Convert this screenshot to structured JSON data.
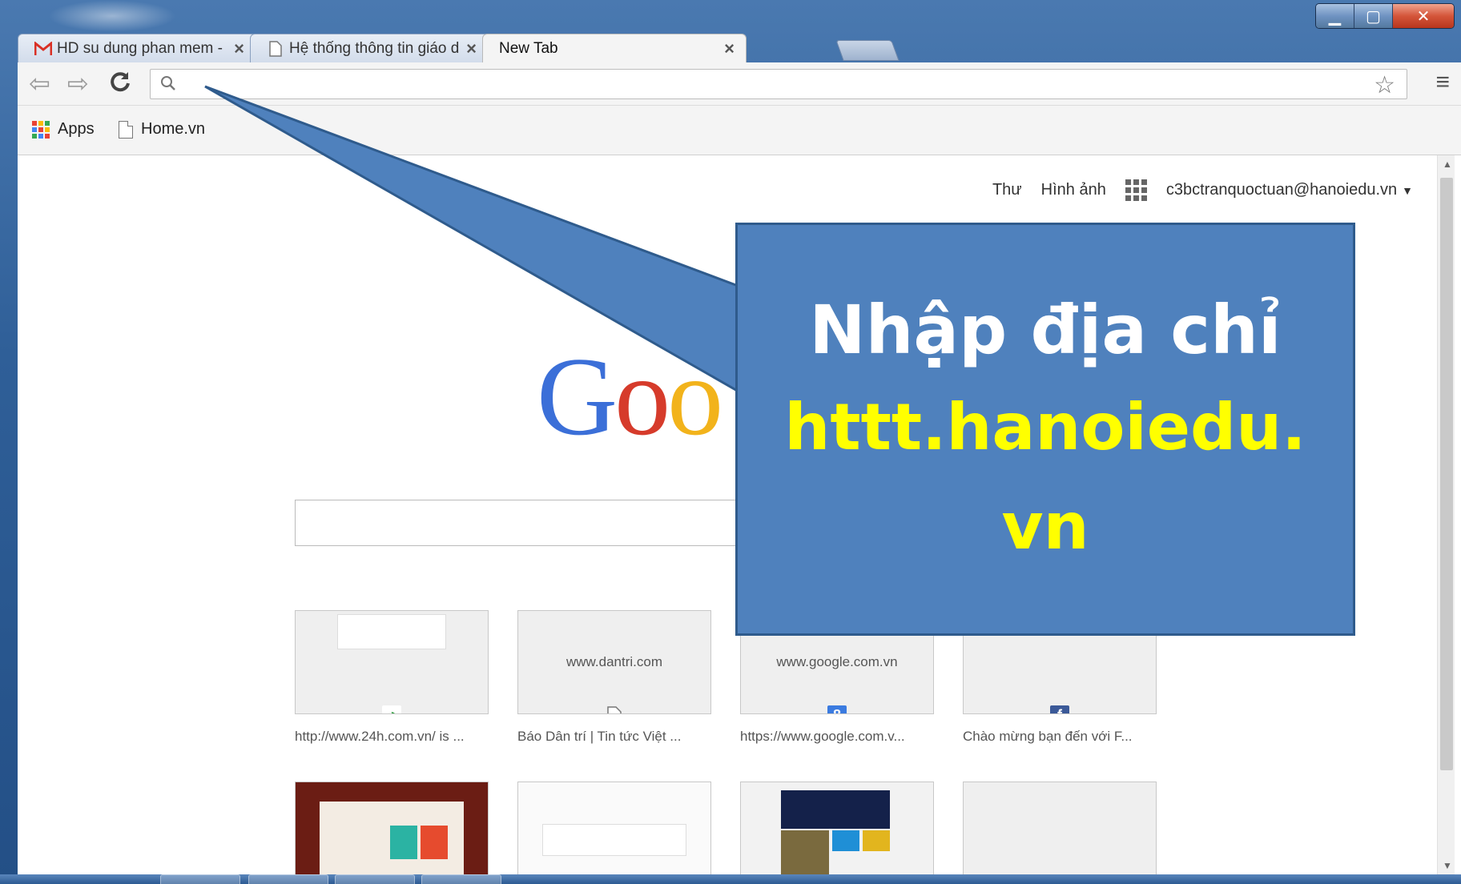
{
  "browser": {
    "tabs": [
      {
        "title": "HD su dung phan mem -",
        "icon": "gmail-icon",
        "active": false
      },
      {
        "title": "Hệ thống thông tin giáo d",
        "icon": "page-icon",
        "active": false
      },
      {
        "title": "New Tab",
        "icon": "",
        "active": true
      }
    ],
    "tab_close_glyph": "×",
    "omnibox": {
      "value": "",
      "placeholder": ""
    },
    "bookmarks": [
      {
        "label": "Apps",
        "icon": "apps-grid-icon"
      },
      {
        "label": "Home.vn",
        "icon": "page-icon"
      }
    ]
  },
  "newtab": {
    "header_links": [
      "Thư",
      "Hình ảnh"
    ],
    "account": "c3bctranquoctuan@hanoiedu.vn",
    "logo_visible": "Goo",
    "tiles_row1": [
      {
        "thumb_text": "",
        "caption": "http://www.24h.com.vn/ is ...",
        "fav_color": "#3fa34d",
        "fav_glyph": "◔"
      },
      {
        "thumb_text": "www.dantri.com",
        "caption": "Báo Dân trí | Tin tức Việt ...",
        "fav_color": "#ffffff",
        "fav_glyph": ""
      },
      {
        "thumb_text": "www.google.com.vn",
        "caption": "https://www.google.com.v...",
        "fav_color": "#3b7be0",
        "fav_glyph": "8"
      },
      {
        "thumb_text": "",
        "caption": "Chào mừng bạn đến với F...",
        "fav_color": "#3b5998",
        "fav_glyph": "f"
      }
    ]
  },
  "callout": {
    "line1": "Nhập địa chỉ",
    "line2": "httt.hanoiedu.",
    "line3": "vn",
    "fill": "#4f81bd",
    "text_color": "#ffffff",
    "highlight_color": "#ffff00"
  }
}
